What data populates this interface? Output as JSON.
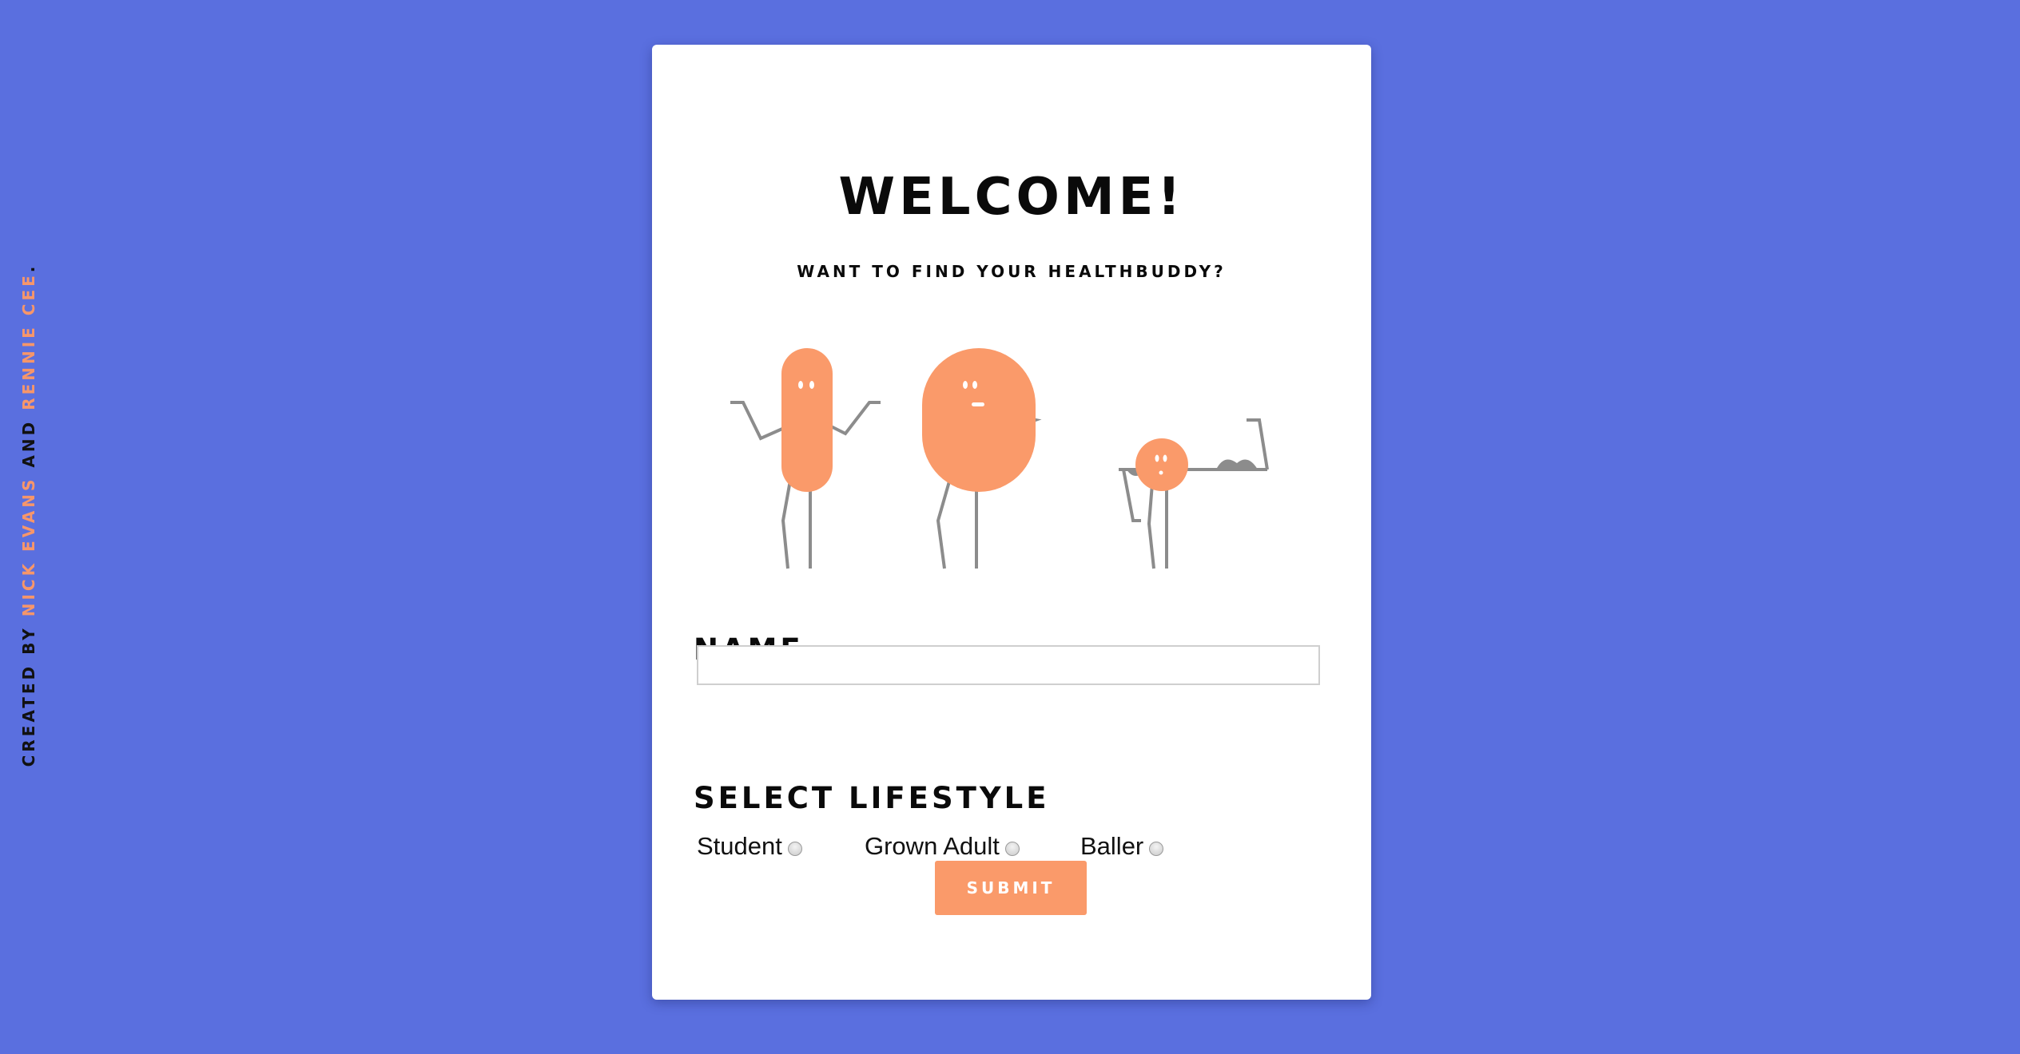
{
  "credit": {
    "prefix": "CREATED BY ",
    "author1": "NICK EVANS",
    "joiner": " AND ",
    "author2": "RENNIE CEE",
    "suffix": "."
  },
  "header": {
    "title": "WELCOME!",
    "subtitle": "WANT TO FIND YOUR HEALTHBUDDY?"
  },
  "form": {
    "name_label": "NAME",
    "name_value": "",
    "name_placeholder": "",
    "lifestyle_label": "SELECT LIFESTYLE",
    "lifestyle_options": [
      "Student",
      "Grown Adult",
      "Baller"
    ],
    "submit_label": "SUBMIT"
  },
  "colors": {
    "background": "#5a6fdf",
    "accent": "#fa9a6a",
    "character_limbs": "#8c8c8c"
  },
  "icons": [
    "tall-buddy-icon",
    "round-buddy-icon",
    "strong-buddy-icon"
  ]
}
